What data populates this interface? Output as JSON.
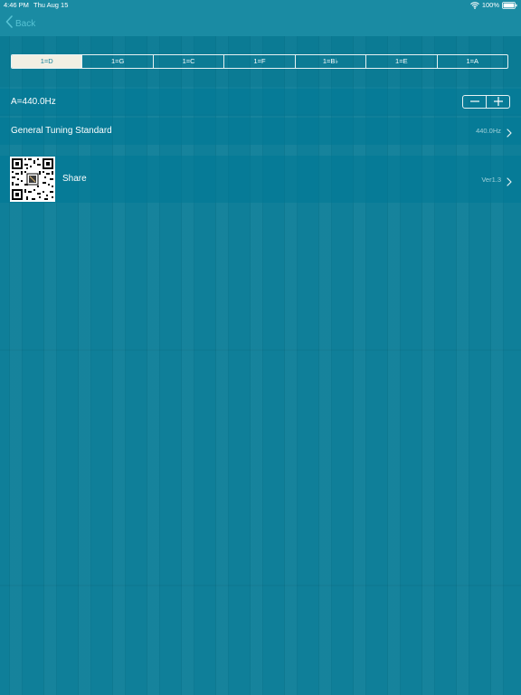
{
  "status_bar": {
    "time": "4:46 PM",
    "date": "Thu Aug 15",
    "battery": "100%",
    "icons": [
      "wifi-icon",
      "battery-icon"
    ]
  },
  "nav": {
    "back_label": "Back",
    "back_icon": "chevron-left-icon",
    "accent_color": "#57c3d4"
  },
  "key_selector": {
    "selected": "1=D",
    "options": [
      "1=D",
      "1=G",
      "1=C",
      "1=F",
      "1=B♭",
      "1=E",
      "1=A"
    ]
  },
  "pitch_row": {
    "label": "A=440.0Hz",
    "decrement_icon": "minus-icon",
    "increment_icon": "plus-icon"
  },
  "standard_row": {
    "label": "General Tuning Standard",
    "value": "440.0Hz"
  },
  "share_row": {
    "label": "Share",
    "version": "Ver1.3",
    "qr_icon": "qr-code-icon"
  },
  "colors": {
    "background": "#0f7f99",
    "bar": "#1a8ba3",
    "selected_segment": "#f2efe3",
    "secondary_text": "#9fd0da"
  }
}
